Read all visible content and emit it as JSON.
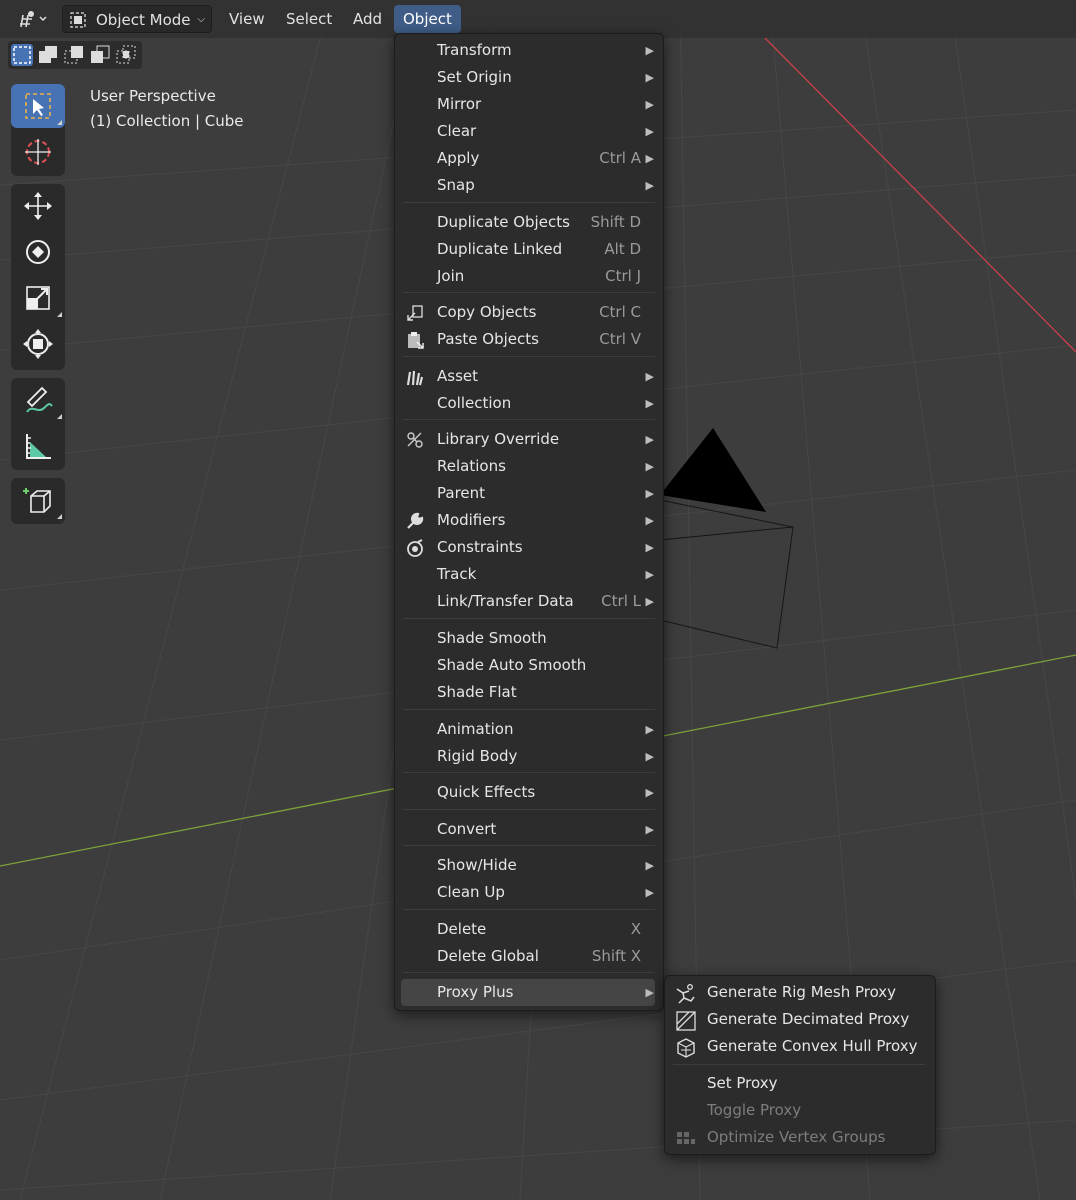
{
  "header": {
    "editor_type_icon": "editor-type-icon",
    "mode": "Object Mode",
    "menus": [
      "View",
      "Select",
      "Add",
      "Object"
    ]
  },
  "overlay": {
    "view_name": "User Perspective",
    "collection_info": "(1) Collection | Cube"
  },
  "object_menu": [
    {
      "label": "Transform",
      "submenu": true
    },
    {
      "label": "Set Origin",
      "submenu": true
    },
    {
      "label": "Mirror",
      "submenu": true
    },
    {
      "label": "Clear",
      "submenu": true
    },
    {
      "label": "Apply",
      "shortcut": "Ctrl A",
      "submenu": true
    },
    {
      "label": "Snap",
      "submenu": true
    },
    {
      "label": "Duplicate Objects",
      "shortcut": "Shift D"
    },
    {
      "label": "Duplicate Linked",
      "shortcut": "Alt D"
    },
    {
      "label": "Join",
      "shortcut": "Ctrl J"
    },
    {
      "label": "Copy Objects",
      "shortcut": "Ctrl C",
      "icon": "copy-icon"
    },
    {
      "label": "Paste Objects",
      "shortcut": "Ctrl V",
      "icon": "paste-icon"
    },
    {
      "label": "Asset",
      "submenu": true,
      "icon": "asset-icon"
    },
    {
      "label": "Collection",
      "submenu": true
    },
    {
      "label": "Library Override",
      "submenu": true,
      "icon": "library-override-icon"
    },
    {
      "label": "Relations",
      "submenu": true
    },
    {
      "label": "Parent",
      "submenu": true
    },
    {
      "label": "Modifiers",
      "submenu": true,
      "icon": "wrench-icon"
    },
    {
      "label": "Constraints",
      "submenu": true,
      "icon": "constraint-icon"
    },
    {
      "label": "Track",
      "submenu": true
    },
    {
      "label": "Link/Transfer Data",
      "shortcut": "Ctrl L",
      "submenu": true
    },
    {
      "label": "Shade Smooth"
    },
    {
      "label": "Shade Auto Smooth"
    },
    {
      "label": "Shade Flat"
    },
    {
      "label": "Animation",
      "submenu": true
    },
    {
      "label": "Rigid Body",
      "submenu": true
    },
    {
      "label": "Quick Effects",
      "submenu": true
    },
    {
      "label": "Convert",
      "submenu": true
    },
    {
      "label": "Show/Hide",
      "submenu": true
    },
    {
      "label": "Clean Up",
      "submenu": true
    },
    {
      "label": "Delete",
      "shortcut": "X"
    },
    {
      "label": "Delete Global",
      "shortcut": "Shift X"
    },
    {
      "label": "Proxy Plus",
      "submenu": true,
      "highlighted": true
    }
  ],
  "proxy_submenu": [
    {
      "label": "Generate Rig Mesh Proxy",
      "icon": "armature-icon"
    },
    {
      "label": "Generate Decimated Proxy",
      "icon": "decimate-icon"
    },
    {
      "label": "Generate Convex Hull Proxy",
      "icon": "convex-hull-icon"
    },
    {
      "label": "Set Proxy"
    },
    {
      "label": "Toggle Proxy",
      "disabled": true
    },
    {
      "label": "Optimize Vertex Groups",
      "disabled": true,
      "icon": "vertex-groups-icon"
    }
  ],
  "toolbar": [
    {
      "name": "select-box-tool",
      "icon": "select-box-icon",
      "active": true
    },
    {
      "name": "cursor-tool",
      "icon": "cursor-icon"
    },
    {
      "name": "move-tool",
      "icon": "move-icon"
    },
    {
      "name": "rotate-tool",
      "icon": "rotate-icon"
    },
    {
      "name": "scale-tool",
      "icon": "scale-icon"
    },
    {
      "name": "transform-tool",
      "icon": "transform-icon"
    },
    {
      "name": "annotate-tool",
      "icon": "annotate-icon"
    },
    {
      "name": "measure-tool",
      "icon": "measure-icon"
    },
    {
      "name": "add-cube-tool",
      "icon": "add-cube-icon"
    }
  ],
  "colors": {
    "viewport_bg": "#3d3d3d",
    "menu_bg": "#2c2c2c",
    "accent": "#4772b3",
    "x_axis": "#c8404a",
    "y_axis": "#7ba33a"
  }
}
